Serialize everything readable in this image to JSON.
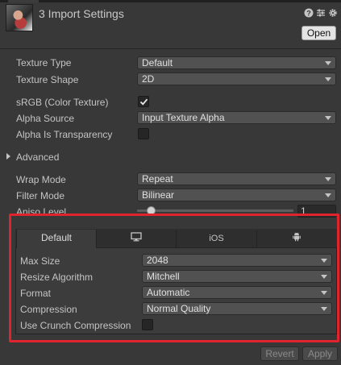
{
  "header": {
    "title": "3 Import Settings",
    "open_label": "Open",
    "icons": [
      "help-icon",
      "presets-icon",
      "gear-icon"
    ]
  },
  "fields": {
    "texture_type": {
      "label": "Texture Type",
      "value": "Default"
    },
    "texture_shape": {
      "label": "Texture Shape",
      "value": "2D"
    },
    "srgb": {
      "label": "sRGB (Color Texture)",
      "checked": true
    },
    "alpha_source": {
      "label": "Alpha Source",
      "value": "Input Texture Alpha"
    },
    "alpha_transparency": {
      "label": "Alpha Is Transparency",
      "checked": false
    }
  },
  "advanced": {
    "label": "Advanced",
    "expanded": false
  },
  "sampling": {
    "wrap_mode": {
      "label": "Wrap Mode",
      "value": "Repeat"
    },
    "filter_mode": {
      "label": "Filter Mode",
      "value": "Bilinear"
    },
    "aniso_level": {
      "label": "Aniso Level",
      "value": "1"
    }
  },
  "platform_tabs": [
    {
      "label": "Default",
      "icon": "default-tab"
    },
    {
      "label": "",
      "icon": "monitor-icon"
    },
    {
      "label": "iOS",
      "icon": "ios-tab"
    },
    {
      "label": "",
      "icon": "android-icon"
    }
  ],
  "platform_settings": {
    "max_size": {
      "label": "Max Size",
      "value": "2048"
    },
    "resize_algorithm": {
      "label": "Resize Algorithm",
      "value": "Mitchell"
    },
    "format": {
      "label": "Format",
      "value": "Automatic"
    },
    "compression": {
      "label": "Compression",
      "value": "Normal Quality"
    },
    "crunch": {
      "label": "Use Crunch Compression",
      "checked": false
    }
  },
  "footer": {
    "revert_label": "Revert",
    "apply_label": "Apply"
  },
  "colors": {
    "highlight": "#e0242d",
    "background": "#383838",
    "field": "#515151"
  }
}
